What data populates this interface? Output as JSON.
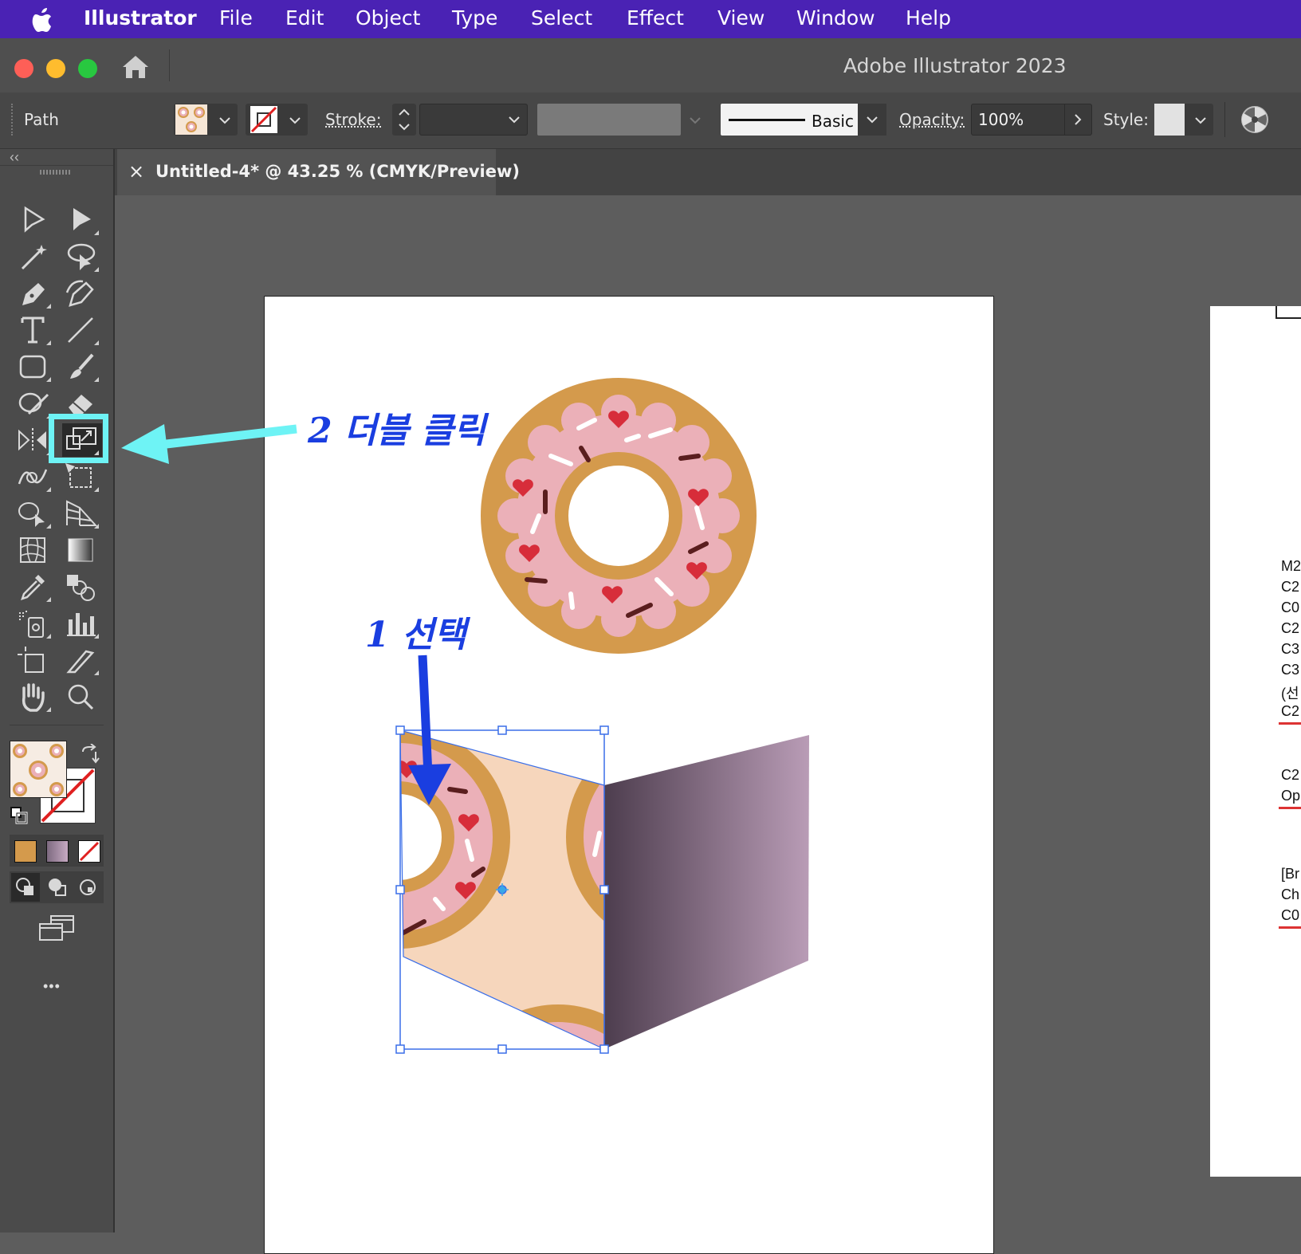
{
  "menu": {
    "apple_icon": "apple-logo-icon",
    "items": [
      "Illustrator",
      "File",
      "Edit",
      "Object",
      "Type",
      "Select",
      "Effect",
      "View",
      "Window",
      "Help"
    ]
  },
  "window": {
    "title": "Adobe Illustrator 2023"
  },
  "control_bar": {
    "selection_type": "Path",
    "stroke_label": "Stroke:",
    "brush_label": "Basic",
    "opacity_label": "Opacity:",
    "opacity_value": "100%",
    "style_label": "Style:"
  },
  "document": {
    "tab_title": "Untitled-4* @ 43.25 % (CMYK/Preview)",
    "close_glyph": "×"
  },
  "toolbar": {
    "collapse_glyph": "‹‹",
    "more_glyph": "•••"
  },
  "annotations": {
    "step2": "2 더블 클릭",
    "step1": "1 선택"
  },
  "right_artboard_text": [
    "M2",
    "C2",
    "C0",
    "C2",
    "C3",
    "C3",
    "(선",
    "C2",
    "C2",
    "Op",
    "[Br",
    "Ch",
    "C0"
  ],
  "colors": {
    "menubar": "#4a22b4",
    "highlight": "#6ef3f5",
    "annotation_blue": "#1a3ee0",
    "donut_dough": "#d49a4c",
    "donut_icing": "#ebb0b8",
    "box_side": "#574656",
    "box_front": "#f6d6bc",
    "selection": "#3a6ee8"
  }
}
